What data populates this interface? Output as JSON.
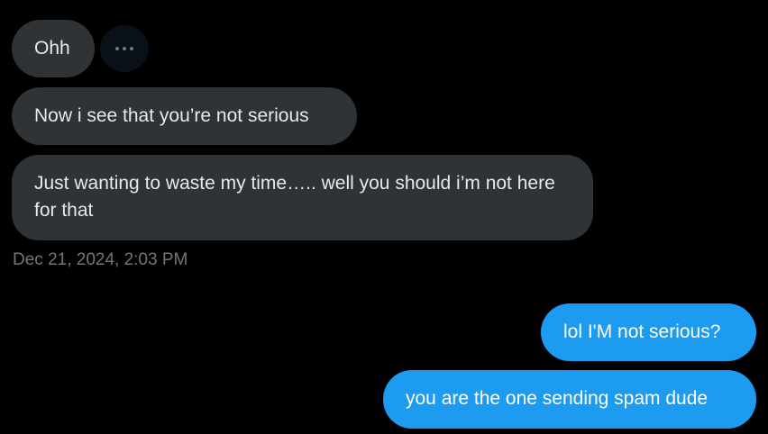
{
  "conversation": {
    "messages": [
      {
        "sender": "them",
        "text": "Ohh"
      },
      {
        "sender": "them",
        "text": "Now i see that you’re not serious"
      },
      {
        "sender": "them",
        "text": "Just wanting to waste my time….. well you should i’m not here for that"
      },
      {
        "sender": "me",
        "text": "lol I'M not serious?"
      },
      {
        "sender": "me",
        "text": "you are the one sending spam dude"
      }
    ],
    "timestamp": "Dec 21, 2024, 2:03 PM",
    "more_icon": "more-horizontal-icon"
  },
  "colors": {
    "background": "#000000",
    "incoming_bubble": "#2f3336",
    "outgoing_bubble": "#1d9bf0",
    "text": "#e7e9ea",
    "timestamp": "#71767b"
  }
}
